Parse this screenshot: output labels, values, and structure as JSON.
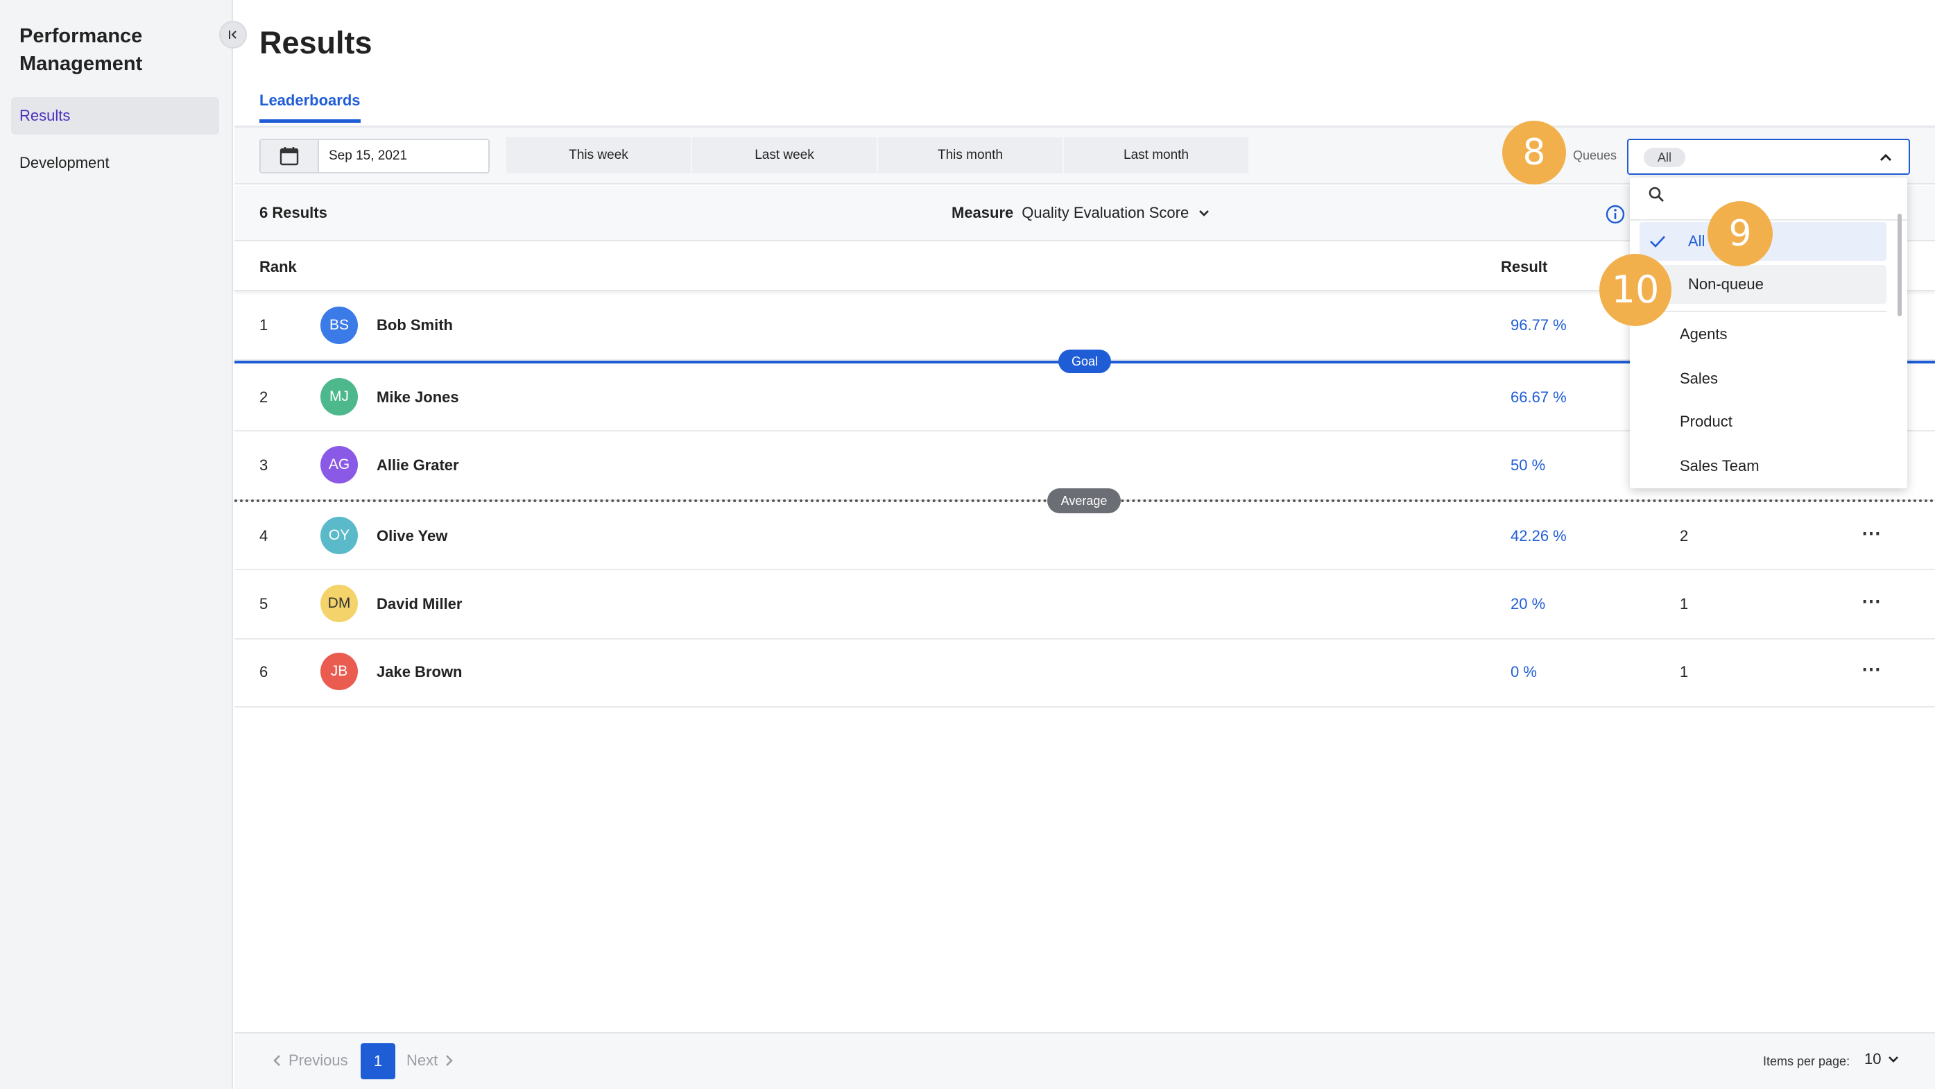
{
  "sidebar": {
    "app_title": "Performance Management",
    "items": [
      {
        "label": "Results"
      },
      {
        "label": "Development"
      }
    ]
  },
  "page": {
    "title": "Results",
    "tab": "Leaderboards"
  },
  "filters": {
    "date": "Sep 15, 2021",
    "ranges": [
      "This week",
      "Last week",
      "This month",
      "Last month"
    ],
    "queues_label": "Queues",
    "queues_selected": "All"
  },
  "summary": {
    "count": "6 Results",
    "measure_label": "Measure",
    "measure_value": "Quality Evaluation Score"
  },
  "table": {
    "headers": {
      "rank": "Rank",
      "result": "Result"
    },
    "rows": [
      {
        "rank": "1",
        "initials": "BS",
        "name": "Bob Smith",
        "result": "96.77 %",
        "count": "",
        "color": "#3b7be8"
      },
      {
        "rank": "2",
        "initials": "MJ",
        "name": "Mike Jones",
        "result": "66.67 %",
        "count": "",
        "color": "#4cb88c"
      },
      {
        "rank": "3",
        "initials": "AG",
        "name": "Allie Grater",
        "result": "50 %",
        "count": "",
        "color": "#8a5ae6"
      },
      {
        "rank": "4",
        "initials": "OY",
        "name": "Olive Yew",
        "result": "42.26 %",
        "count": "2",
        "color": "#5bbac9"
      },
      {
        "rank": "5",
        "initials": "DM",
        "name": "David Miller",
        "result": "20 %",
        "count": "1",
        "color": "#f4d46a"
      },
      {
        "rank": "6",
        "initials": "JB",
        "name": "Jake Brown",
        "result": "0 %",
        "count": "1",
        "color": "#ea5b50"
      }
    ],
    "more_glyph": "⋯"
  },
  "markers": {
    "goal": "Goal",
    "average": "Average"
  },
  "dropdown": {
    "options": [
      "All",
      "Non-queue",
      "Agents",
      "Sales",
      "Product",
      "Sales Team"
    ]
  },
  "badges": [
    "8",
    "9",
    "10"
  ],
  "pagination": {
    "previous": "Previous",
    "current": "1",
    "next": "Next",
    "items_per_page_label": "Items per page:",
    "items_per_page_value": "10"
  },
  "colors": {
    "accent": "#1f5dd6",
    "badge": "#f1b04c"
  }
}
